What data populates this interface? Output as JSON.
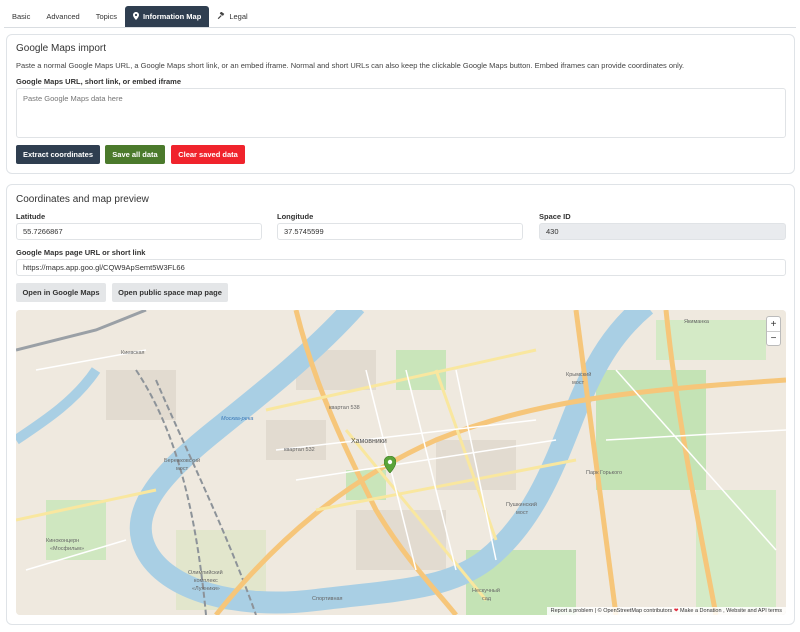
{
  "tabs": [
    {
      "label": "Basic",
      "icon": ""
    },
    {
      "label": "Advanced",
      "icon": ""
    },
    {
      "label": "Topics",
      "icon": ""
    },
    {
      "label": "Information Map",
      "icon": "map-pin-icon"
    },
    {
      "label": "Legal",
      "icon": "gavel-icon"
    }
  ],
  "import_panel": {
    "title": "Google Maps import",
    "help": "Paste a normal Google Maps URL, a Google Maps short link, or an embed iframe. Normal and short URLs can also keep the clickable Google Maps button. Embed iframes can provide coordinates only.",
    "field_label": "Google Maps URL, short link, or embed iframe",
    "placeholder": "Paste Google Maps data here",
    "buttons": {
      "extract": "Extract coordinates",
      "save": "Save all data",
      "clear": "Clear saved data"
    }
  },
  "coords_panel": {
    "title": "Coordinates and map preview",
    "latitude_label": "Latitude",
    "latitude_value": "55.7266867",
    "longitude_label": "Longitude",
    "longitude_value": "37.5745599",
    "space_id_label": "Space ID",
    "space_id_value": "430",
    "gmaps_link_label": "Google Maps page URL or short link",
    "gmaps_link_value": "https://maps.app.goo.gl/CQW9ApSemt5W3FL66",
    "buttons": {
      "open_google": "Open in Google Maps",
      "open_public": "Open public space map page"
    }
  },
  "map": {
    "zoom_in": "+",
    "zoom_out": "−",
    "labels": {
      "khamovniki": "Хамовники",
      "kvartal538": "квартал 538",
      "kvartal532": "квартал 532",
      "krymsky": "Крымский",
      "most": "мост",
      "yakimanka": "Якиманка",
      "pushkinsky": "Пушкинский",
      "most2": "мост",
      "berezhkovsky": "Бережковский",
      "most3": "мост",
      "olympic1": "Олимпийский",
      "olympic2": "комплекс",
      "olympic3": "«Лужники»",
      "kinotsentr1": "Киноконцерн",
      "kinotsentr2": "«Мосфильм»",
      "park": "Парк Горького",
      "neskuchny1": "Нескучный",
      "neskuchny2": "сад",
      "kievsk": "Киевская",
      "sports": "Спортивная",
      "moskva_river": "Москва-река"
    },
    "attribution": {
      "report": "Report a problem",
      "osm": "© OpenStreetMap contributors",
      "donate": "Make a Donation",
      "terms": "Website and API terms"
    },
    "colors": {
      "water": "#a9cfe4",
      "park": "#c4e3b5",
      "road_major": "#f6c67a",
      "road_mid": "#f9e79f",
      "pin": "#5ba43a"
    }
  }
}
